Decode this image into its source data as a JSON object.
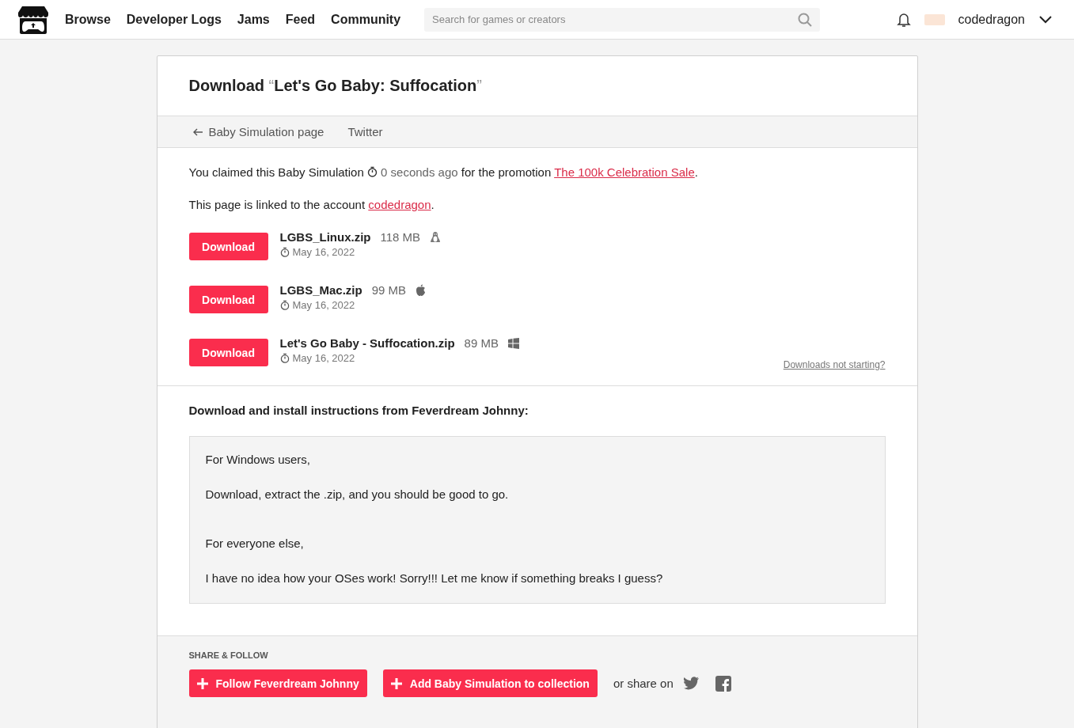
{
  "nav": {
    "links": [
      "Browse",
      "Developer Logs",
      "Jams",
      "Feed",
      "Community"
    ],
    "search": {
      "placeholder": "Search for games or creators"
    },
    "username": "codedragon"
  },
  "header": {
    "prefix": "Download",
    "open_quote": "“",
    "game": "Let's Go Baby: Suffocation",
    "close_quote": "”"
  },
  "subnav": [
    {
      "label": "Baby Simulation page",
      "kind": "back"
    },
    {
      "label": "Twitter",
      "kind": "plain"
    }
  ],
  "claim": {
    "before": "You claimed this Baby Simulation",
    "time": "0 seconds ago",
    "middle": "for the promotion",
    "link": "The 100k Celebration Sale",
    "end": "."
  },
  "linked": {
    "before": "This page is linked to the account",
    "link": "codedragon",
    "end": "."
  },
  "uploads": [
    {
      "button": "Download",
      "name": "LGBS_Linux.zip",
      "size": "118 MB",
      "kind": "linux",
      "date": "May 16, 2022"
    },
    {
      "button": "Download",
      "name": "LGBS_Mac.zip",
      "size": "99 MB",
      "kind": "mac",
      "date": "May 16, 2022"
    },
    {
      "button": "Download",
      "name": "Let's Go Baby - Suffocation.zip",
      "size": "89 MB",
      "kind": "windows",
      "date": "May 16, 2022"
    }
  ],
  "help_link": "Downloads not starting?",
  "instructions": {
    "heading": "Download and install instructions from Feverdream Johnny:",
    "groups": [
      [
        "For Windows users,",
        "Download, extract the .zip, and you should be good to go."
      ],
      [
        "For everyone else,",
        "I have no idea how your OSes work! Sorry!!! Let me know if something breaks I guess?"
      ]
    ]
  },
  "share": {
    "heading": "SHARE & FOLLOW",
    "buttons": [
      "Follow Feverdream Johnny",
      "Add Baby Simulation to collection"
    ],
    "or_share": "or share on"
  }
}
